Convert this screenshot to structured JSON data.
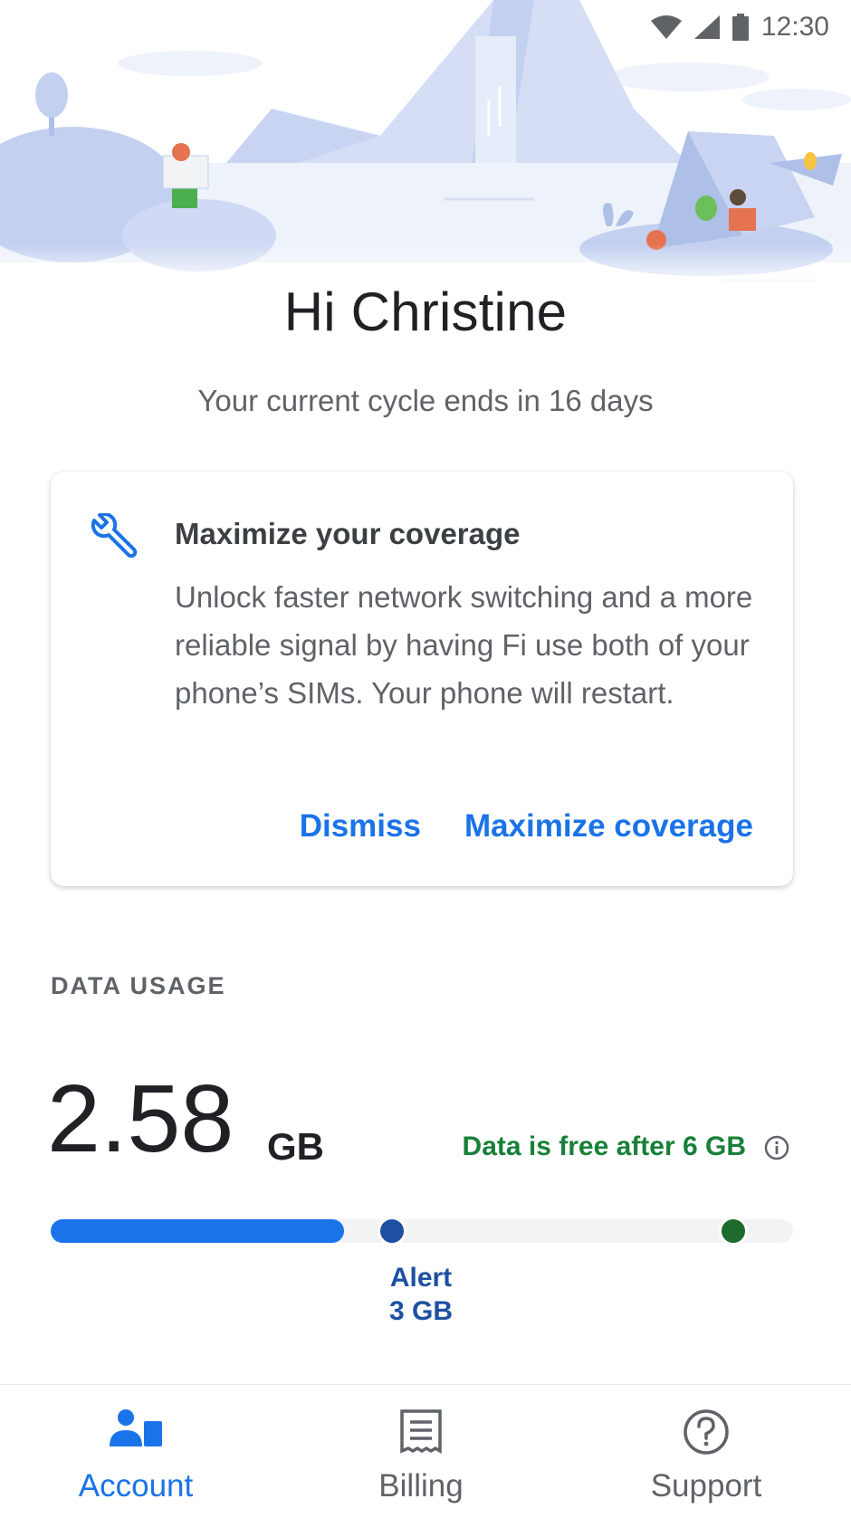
{
  "status_bar": {
    "time": "12:30",
    "icons": [
      "wifi-icon",
      "signal-icon",
      "battery-icon"
    ]
  },
  "greeting": "Hi Christine",
  "cycle_text": "Your current cycle ends in 16 days",
  "card": {
    "icon": "wrench-icon",
    "title": "Maximize your coverage",
    "body": "Unlock faster network switching and a more reliable signal by having Fi use both of your phone’s SIMs. Your phone will restart.",
    "dismiss_label": "Dismiss",
    "action_label": "Maximize coverage"
  },
  "data_usage": {
    "section_label": "DATA USAGE",
    "value": "2.58",
    "unit": "GB",
    "free_note": "Data is free after 6 GB",
    "info_icon": "info-icon",
    "used_gb": 2.58,
    "alert_gb": 3,
    "free_after_gb": 6,
    "alert_label": "Alert",
    "alert_value": "3 GB"
  },
  "nav": {
    "items": [
      {
        "label": "Account",
        "icon": "account-icon",
        "active": true
      },
      {
        "label": "Billing",
        "icon": "receipt-icon",
        "active": false
      },
      {
        "label": "Support",
        "icon": "help-circle-icon",
        "active": false
      }
    ]
  },
  "colors": {
    "accent": "#1a73e8",
    "alert": "#1e50a2",
    "free": "#188038"
  }
}
